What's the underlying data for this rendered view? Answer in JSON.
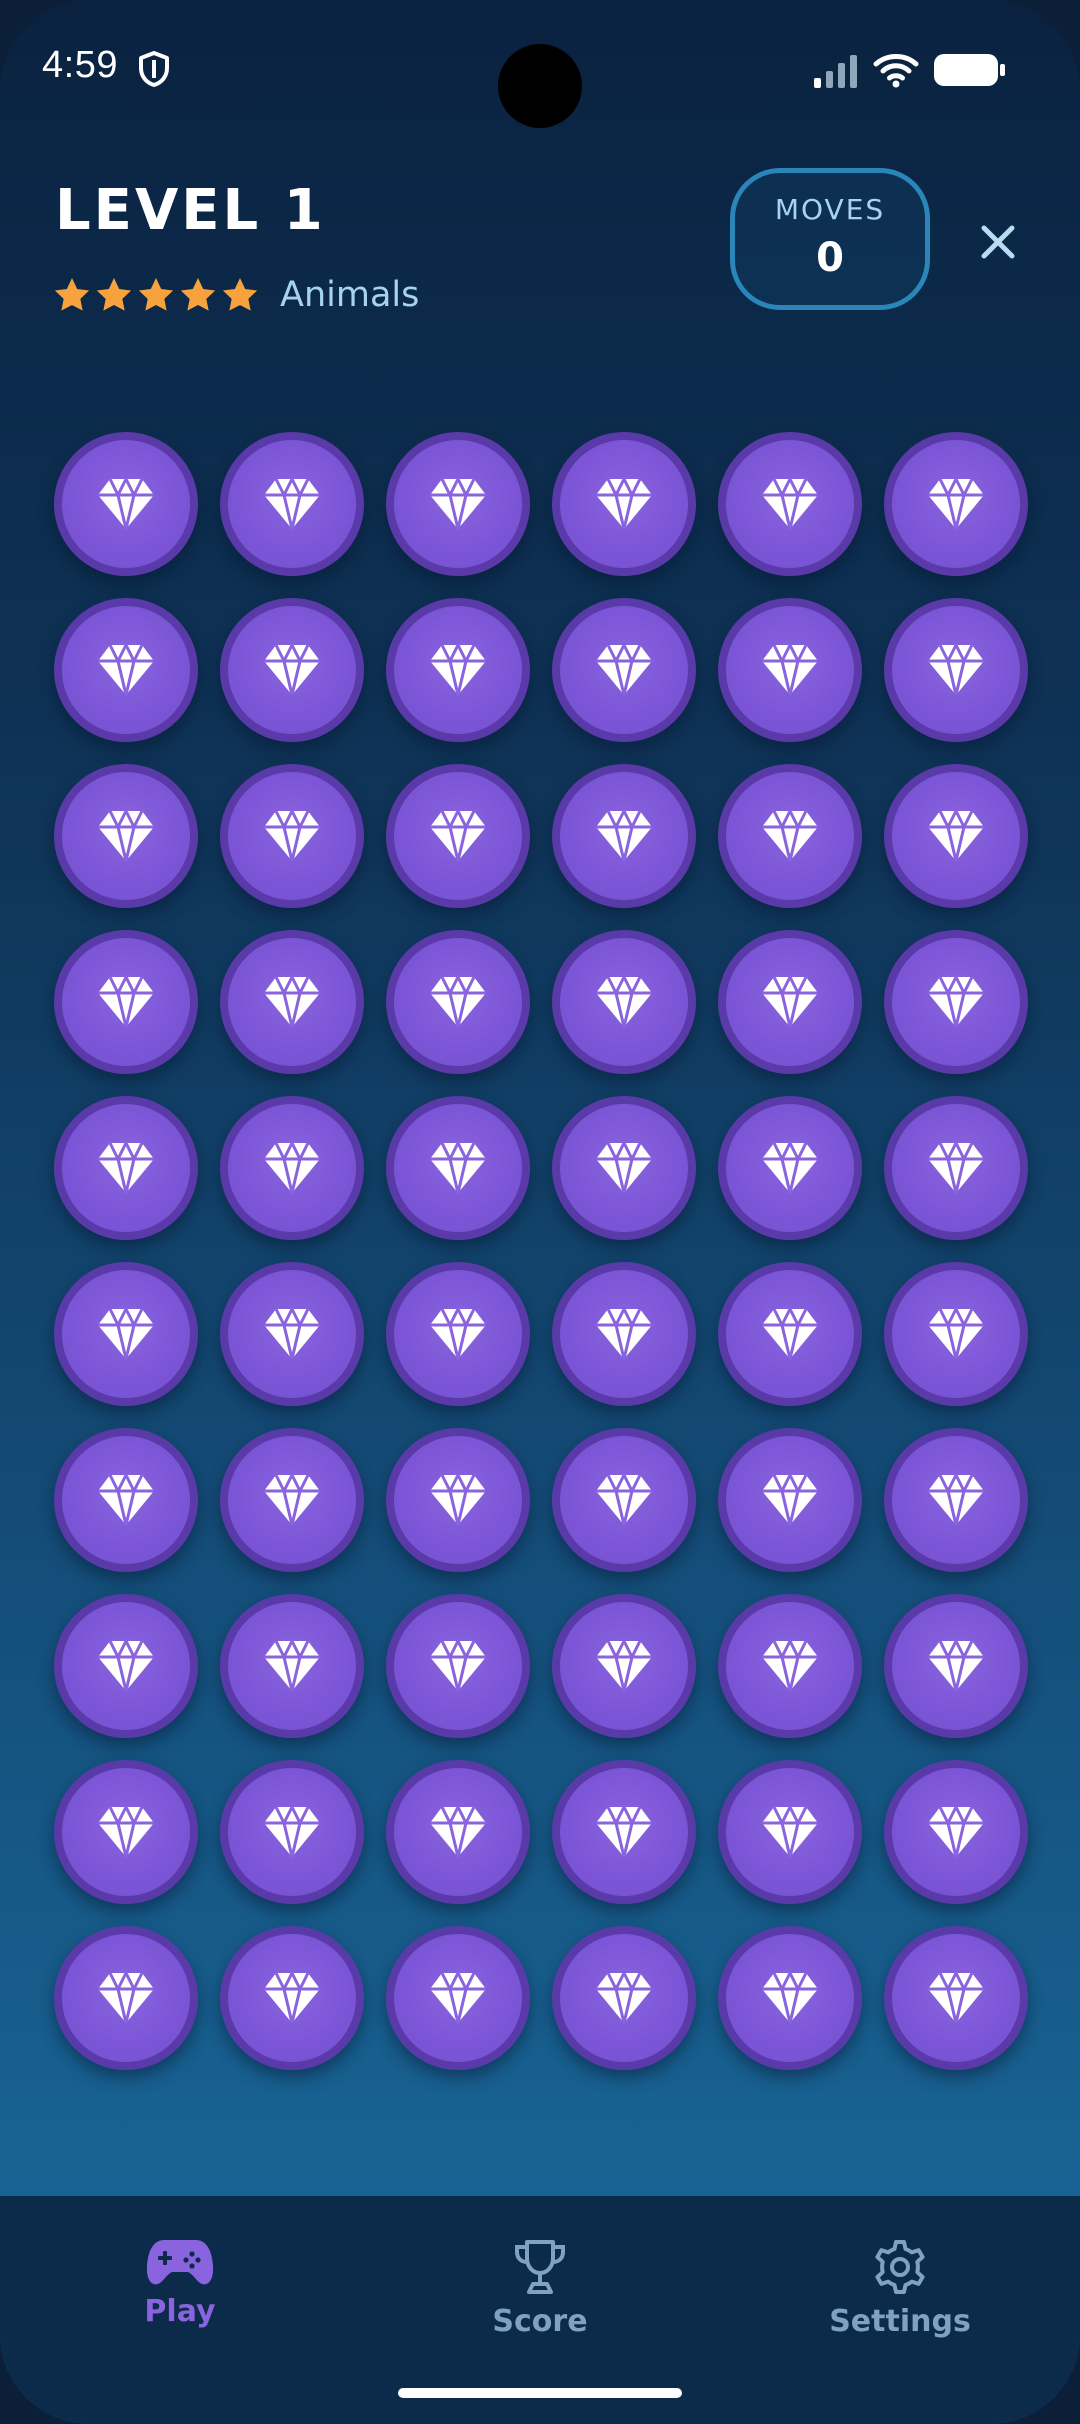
{
  "status_bar": {
    "time": "4:59",
    "icons": [
      "shield-icon",
      "signal-icon",
      "wifi-icon",
      "battery-icon"
    ]
  },
  "header": {
    "level_title": "LEVEL 1",
    "rating_stars": 5,
    "rating_max": 5,
    "category": "Animals",
    "moves_label": "MOVES",
    "moves_value": "0",
    "close_icon": "close-icon"
  },
  "grid": {
    "columns": 6,
    "rows": 10,
    "tile_icon": "gem-icon"
  },
  "bottom_nav": {
    "items": [
      {
        "label": "Play",
        "icon": "gamepad-icon",
        "active": true
      },
      {
        "label": "Score",
        "icon": "trophy-icon",
        "active": false
      },
      {
        "label": "Settings",
        "icon": "gear-icon",
        "active": false
      }
    ]
  },
  "colors": {
    "background_top": "#0a2240",
    "background_bottom": "#1a6b9d",
    "tile_fill": "#7b55d6",
    "tile_border": "#5a3aa8",
    "star": "#f7a23c",
    "category_text": "#a6d3f0",
    "moves_border": "#2a86b8",
    "nav_background": "#0c2a4a",
    "nav_active": "#8a63de",
    "nav_inactive": "#7fa2c0"
  }
}
